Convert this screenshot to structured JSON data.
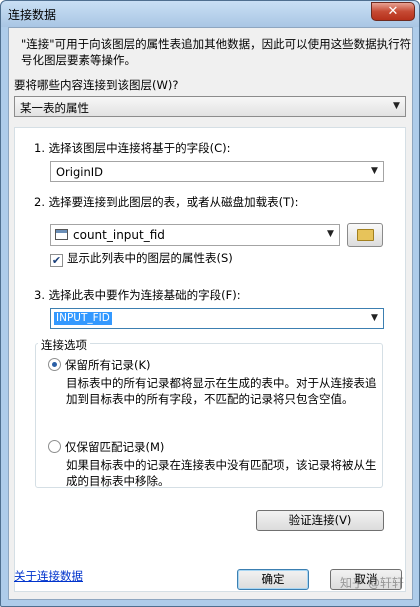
{
  "window": {
    "title": "连接数据",
    "close_glyph": "✕"
  },
  "description": "\"连接\"可用于向该图层的属性表追加其他数据，因此可以使用这些数据执行符号化图层要素等操作。",
  "what_label": "要将哪些内容连接到该图层(W)?",
  "join_type": {
    "value": "某一表的属性",
    "options": [
      "某一表的属性"
    ]
  },
  "step1": {
    "label": "1. 选择该图层中连接将基于的字段(C):",
    "value": "OriginID"
  },
  "step2": {
    "label": "2. 选择要连接到此图层的表，或者从磁盘加载表(T):",
    "value": "count_input_fid",
    "checkbox_label": "显示此列表中的图层的属性表(S)",
    "checkbox_checked": true
  },
  "step3": {
    "label": "3. 选择此表中要作为连接基础的字段(F):",
    "value": "INPUT_FID"
  },
  "join_options": {
    "title": "连接选项",
    "keep_all": {
      "label": "保留所有记录(K)",
      "selected": true,
      "description": "目标表中的所有记录都将显示在生成的表中。对于从连接表追加到目标表中的所有字段，不匹配的记录将只包含空值。"
    },
    "keep_matching": {
      "label": "仅保留匹配记录(M)",
      "selected": false,
      "description": "如果目标表中的记录在连接表中没有匹配项，该记录将被从生成的目标表中移除。"
    }
  },
  "buttons": {
    "verify": "验证连接(V)",
    "ok": "确定",
    "cancel": "取消"
  },
  "help_link": "关于连接数据",
  "watermark": "知乎 @轩轩"
}
